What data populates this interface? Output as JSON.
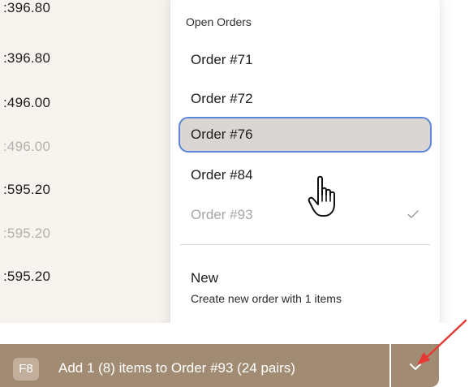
{
  "prices": [
    {
      "text": ":396.80",
      "dim": false
    },
    {
      "text": ":396.80",
      "dim": false
    },
    {
      "text": ":496.00",
      "dim": false
    },
    {
      "text": ":496.00",
      "dim": true
    },
    {
      "text": ":595.20",
      "dim": false
    },
    {
      "text": ":595.20",
      "dim": true
    },
    {
      "text": ":595.20",
      "dim": false
    }
  ],
  "dropdown": {
    "header": "Open Orders",
    "orders": [
      {
        "label": "Order #71",
        "state": "normal"
      },
      {
        "label": "Order #72",
        "state": "normal"
      },
      {
        "label": "Order #76",
        "state": "selected"
      },
      {
        "label": "Order #84",
        "state": "normal"
      },
      {
        "label": "Order #93",
        "state": "current"
      }
    ],
    "new_title": "New",
    "new_subtitle": "Create new order with 1 items"
  },
  "action": {
    "shortcut": "F8",
    "label": "Add 1 (8) items to Order #93 (24 pairs)"
  },
  "colors": {
    "button_bg": "#a18c73",
    "selection_border": "#5b86d9",
    "annotation_arrow": "#e53935"
  }
}
